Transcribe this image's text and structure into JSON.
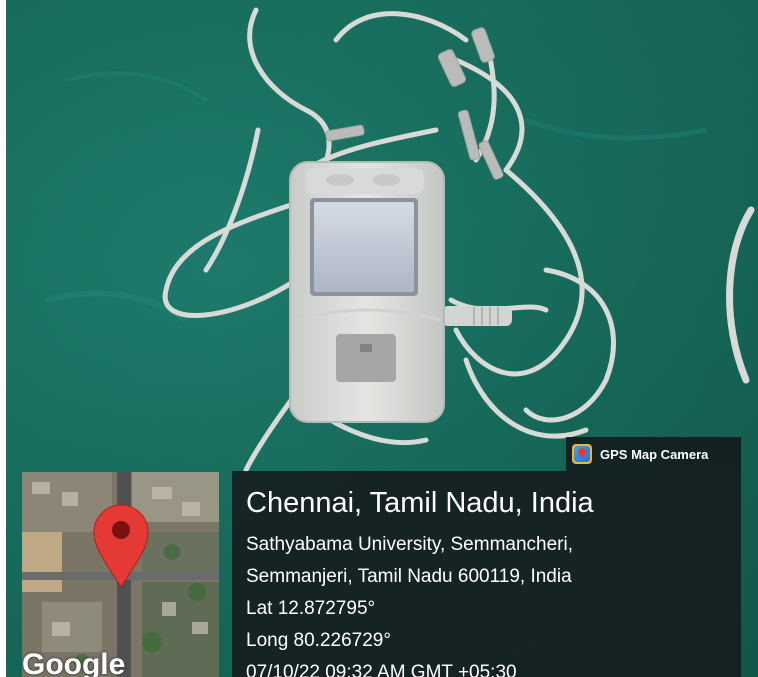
{
  "badge": {
    "app_name": "GPS Map Camera",
    "icon": "gps-map-camera-icon"
  },
  "location": {
    "title": "Chennai, Tamil Nadu, India",
    "address_line1": "Sathyabama University, Semmancheri,",
    "address_line2": "Semmanjeri, Tamil Nadu 600119, India",
    "latitude": "Lat 12.872795°",
    "longitude": "Long 80.226729°",
    "timestamp": "07/10/22 09:32 AM GMT +05:30"
  },
  "map": {
    "attribution": "Google",
    "marker_icon": "map-pin-icon",
    "marker_color": "#e53935"
  },
  "colors": {
    "cloth": "#19705f",
    "panel": "#161e20",
    "device": "#dcdedb"
  }
}
